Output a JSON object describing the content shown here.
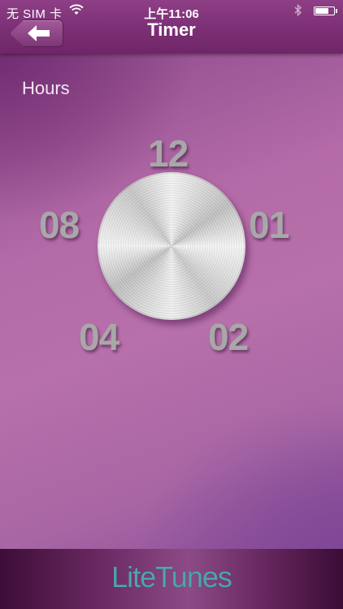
{
  "status_bar": {
    "carrier": "无 SIM 卡",
    "time": "上午11:06",
    "bluetooth_icon": "bluetooth-icon",
    "wifi_icon": "wifi-icon",
    "battery_icon": "battery-icon",
    "battery_level": 0.68
  },
  "nav": {
    "title": "Timer",
    "back_icon": "arrow-left-icon"
  },
  "main": {
    "label": "Hours",
    "dial_numbers": [
      "12",
      "08",
      "01",
      "04",
      "02"
    ]
  },
  "footer": {
    "brand": "LiteTunes"
  },
  "colors": {
    "nav_bar": "#7c2f74",
    "background": "#b46ba8",
    "dial_number": "#a8a8a8",
    "brand_text": "#4ba7a7"
  }
}
